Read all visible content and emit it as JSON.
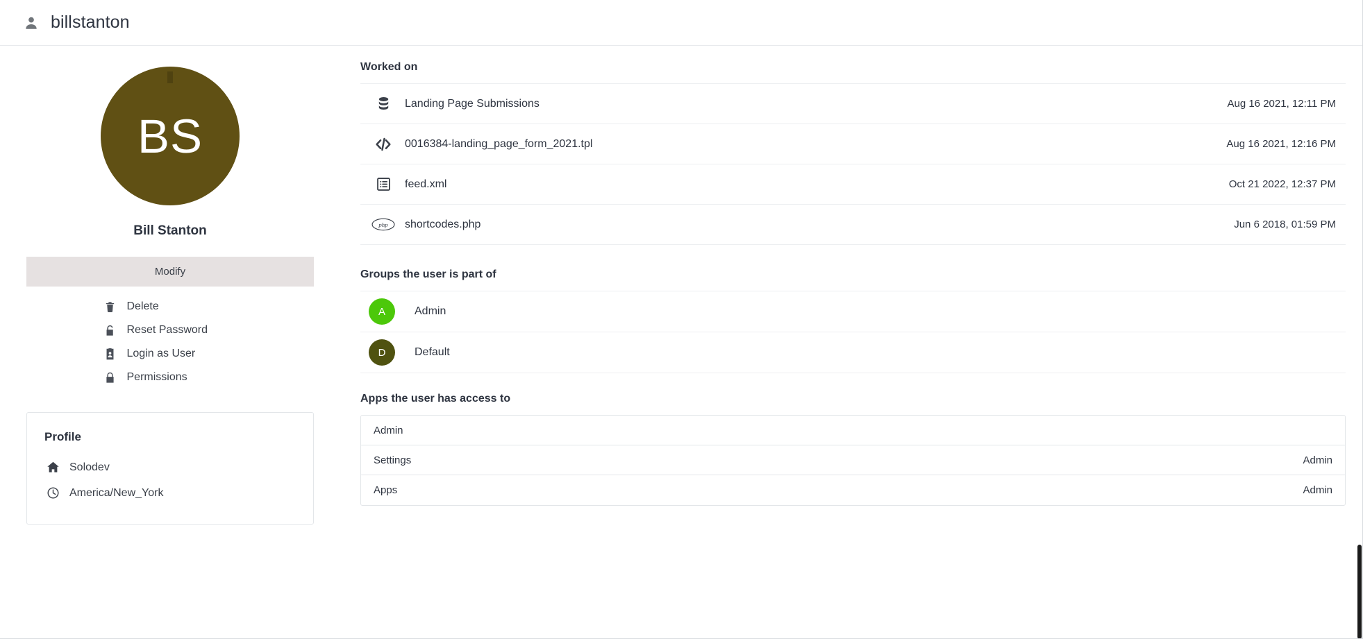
{
  "header": {
    "username": "billstanton",
    "user_icon": "person-icon"
  },
  "profile_panel": {
    "avatar": {
      "initials": "BS",
      "color": "#605014"
    },
    "display_name": "Bill Stanton",
    "modify_label": "Modify",
    "actions": [
      {
        "label": "Delete",
        "icon": "trash-icon"
      },
      {
        "label": "Reset Password",
        "icon": "unlock-icon"
      },
      {
        "label": "Login as User",
        "icon": "id-badge-icon"
      },
      {
        "label": "Permissions",
        "icon": "lock-icon"
      }
    ],
    "card": {
      "title": "Profile",
      "rows": [
        {
          "label": "Solodev",
          "icon": "home-icon"
        },
        {
          "label": "America/New_York",
          "icon": "clock-icon"
        }
      ]
    }
  },
  "worked_on": {
    "title": "Worked on",
    "items": [
      {
        "name": "Landing Page Submissions",
        "date": "Aug 16 2021, 12:11 PM",
        "icon": "database-icon"
      },
      {
        "name": "0016384-landing_page_form_2021.tpl",
        "date": "Aug 16 2021, 12:16 PM",
        "icon": "code-icon"
      },
      {
        "name": "feed.xml",
        "date": "Oct 21 2022, 12:37 PM",
        "icon": "list-document-icon"
      },
      {
        "name": "shortcodes.php",
        "date": "Jun 6 2018, 01:59 PM",
        "icon": "php-icon"
      }
    ]
  },
  "groups": {
    "title": "Groups the user is part of",
    "items": [
      {
        "name": "Admin",
        "initial": "A",
        "color": "#4CC80A"
      },
      {
        "name": "Default",
        "initial": "D",
        "color": "#4F5210"
      }
    ]
  },
  "apps": {
    "title": "Apps the user has access to",
    "rows": [
      {
        "name": "Admin",
        "role": ""
      },
      {
        "name": "Settings",
        "role": "Admin"
      },
      {
        "name": "Apps",
        "role": "Admin"
      }
    ]
  }
}
